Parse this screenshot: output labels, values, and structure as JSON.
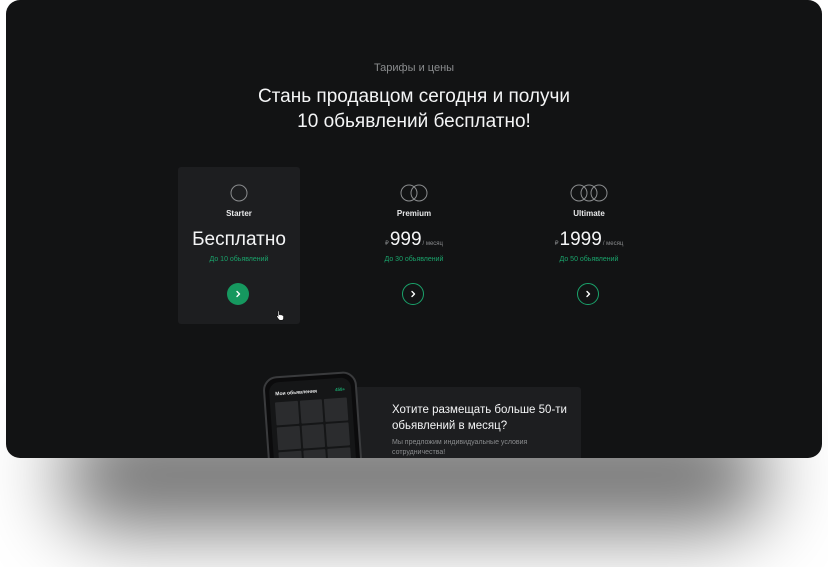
{
  "section": {
    "eyebrow": "Тарифы и цены",
    "headline_line1": "Стань продавцом сегодня и получи",
    "headline_line2": "10 обьявлений бесплатно!"
  },
  "plans": [
    {
      "name": "Starter",
      "price_text": "Бесплатно",
      "limit": "До 10 обьявлений",
      "icon": "one-ring-icon",
      "active": true
    },
    {
      "name": "Premium",
      "currency": "₽",
      "price": "999",
      "period": "/ месяц",
      "limit": "До 30 обьявлений",
      "icon": "two-rings-icon",
      "active": false
    },
    {
      "name": "Ultimate",
      "currency": "₽",
      "price": "1999",
      "period": "/ месяц",
      "limit": "До 50 обьявлений",
      "icon": "three-rings-icon",
      "active": false
    }
  ],
  "promo": {
    "title": "Хотите размещать больше 50-ти обьявлений в месяц?",
    "text": "Мы предложим индивидуальные условия сотрудничества!"
  },
  "phone": {
    "title": "Мои обьявления",
    "badge": "458+"
  },
  "colors": {
    "background": "#121314",
    "card": "#1d1e20",
    "accent": "#1aa36b",
    "accent_fill": "#16985f",
    "text": "#f4f5f6",
    "muted": "#8a8c8e"
  }
}
